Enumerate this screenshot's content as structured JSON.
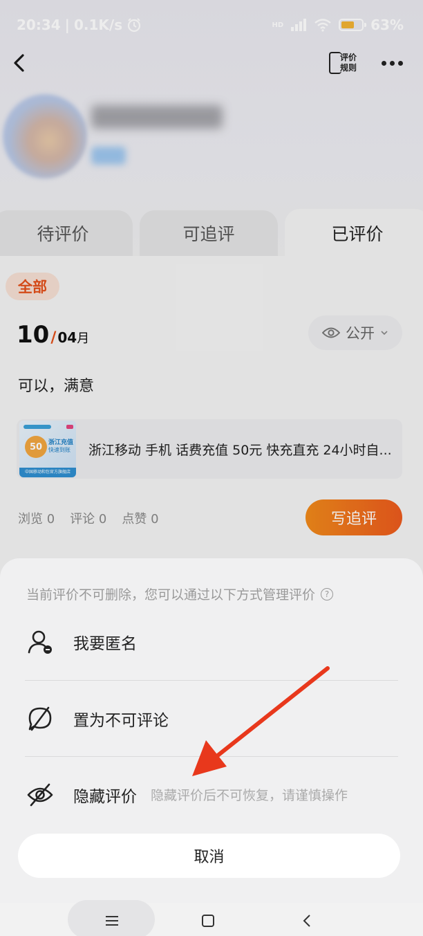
{
  "status_bar": {
    "time": "20:34",
    "speed": "0.1K/s",
    "network": "HD",
    "battery": "63%",
    "battery_level": 0.63
  },
  "nav": {
    "rules_label_1": "评价",
    "rules_label_2": "规则"
  },
  "tabs": [
    {
      "label": "待评价",
      "active": false
    },
    {
      "label": "可追评",
      "active": false
    },
    {
      "label": "已评价",
      "active": true
    }
  ],
  "filter": {
    "label": "全部"
  },
  "review": {
    "day": "10",
    "month": "04",
    "month_unit": "月",
    "visibility": "公开",
    "text": "可以，满意",
    "product": {
      "title": "浙江移动 手机 话费充值 50元 快充直充 24小时自...",
      "thumb_badge": "50",
      "thumb_label_1": "浙江充值",
      "thumb_label_2": "快速到账",
      "thumb_footer": "中国移动和包官方旗舰店"
    },
    "stats": {
      "views": "浏览 0",
      "comments": "评论 0",
      "likes": "点赞 0"
    },
    "followup_button": "写追评"
  },
  "sheet": {
    "hint": "当前评价不可删除，您可以通过以下方式管理评价",
    "help_icon": "?",
    "options": [
      {
        "label": "我要匿名",
        "icon": "anonymous-user-icon",
        "note": ""
      },
      {
        "label": "置为不可评论",
        "icon": "no-comment-icon",
        "note": ""
      },
      {
        "label": "隐藏评价",
        "icon": "hidden-eye-icon",
        "note": "隐藏评价后不可恢复，请谨慎操作"
      }
    ],
    "cancel": "取消"
  },
  "colors": {
    "accent": "#e4501a",
    "button_gradient_start": "#f08a1a",
    "button_gradient_end": "#ec5a1e",
    "annotation_arrow": "#e8381c"
  }
}
